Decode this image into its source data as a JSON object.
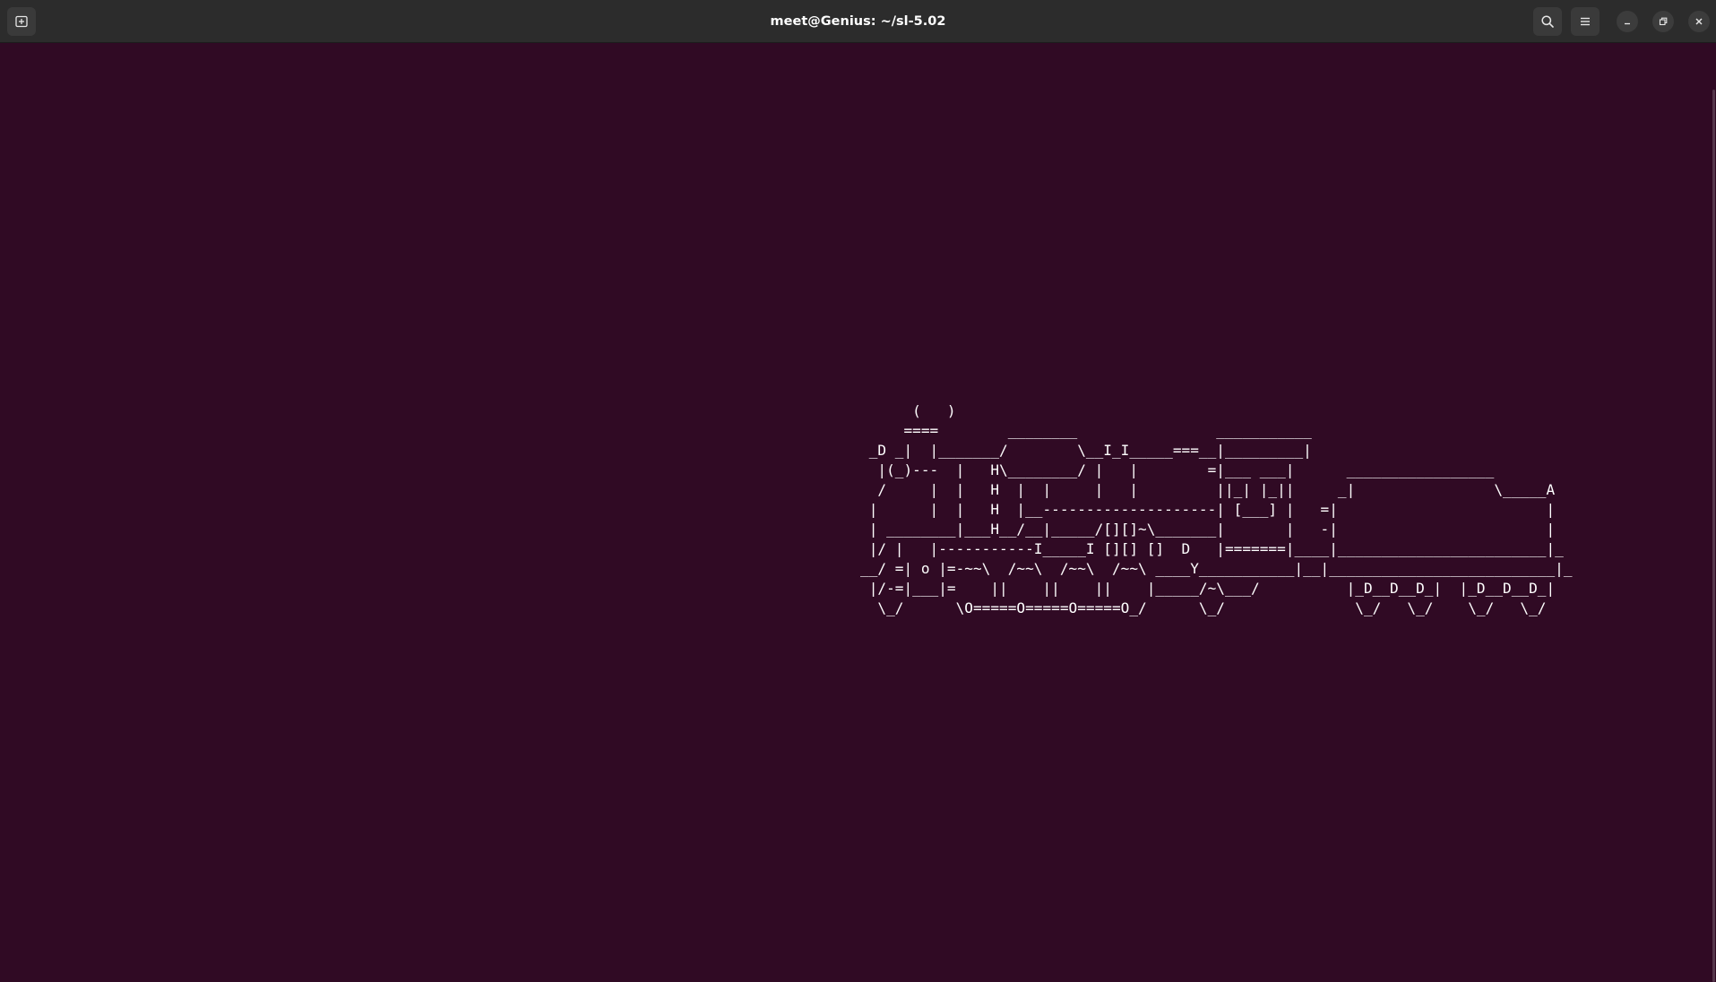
{
  "window": {
    "title": "meet@Genius: ~/sl-5.02"
  },
  "titlebar": {
    "new_tab_icon": "new-tab-icon",
    "search_icon": "search-icon",
    "menu_icon": "hamburger-menu-icon",
    "minimize_icon": "minimize-icon",
    "restore_icon": "restore-icon",
    "close_icon": "close-icon"
  },
  "terminal": {
    "background": "#300a24",
    "foreground": "#ffffff",
    "train_lines": [
      "      (   )",
      "     ====        ________                ___________",
      " _D _|  |_______/        \\__I_I_____===__|_________|",
      "  |(_)---  |   H\\________/ |   |        =|___ ___|      _________________",
      "  /     |  |   H  |  |     |   |         ||_| |_||     _|                \\_____A",
      " |      |  |   H  |__--------------------| [___] |   =|                        |",
      " | ________|___H__/__|_____/[][]~\\_______|       |   -|                        |",
      " |/ |   |-----------I_____I [][] []  D   |=======|____|________________________|_",
      "__/ =| o |=-~~\\  /~~\\  /~~\\  /~~\\ ____Y___________|__|__________________________|_",
      " |/-=|___|=    ||    ||    ||    |_____/~\\___/          |_D__D__D_|  |_D__D__D_|",
      "  \\_/      \\O=====O=====O=====O_/      \\_/               \\_/   \\_/    \\_/   \\_/"
    ]
  }
}
